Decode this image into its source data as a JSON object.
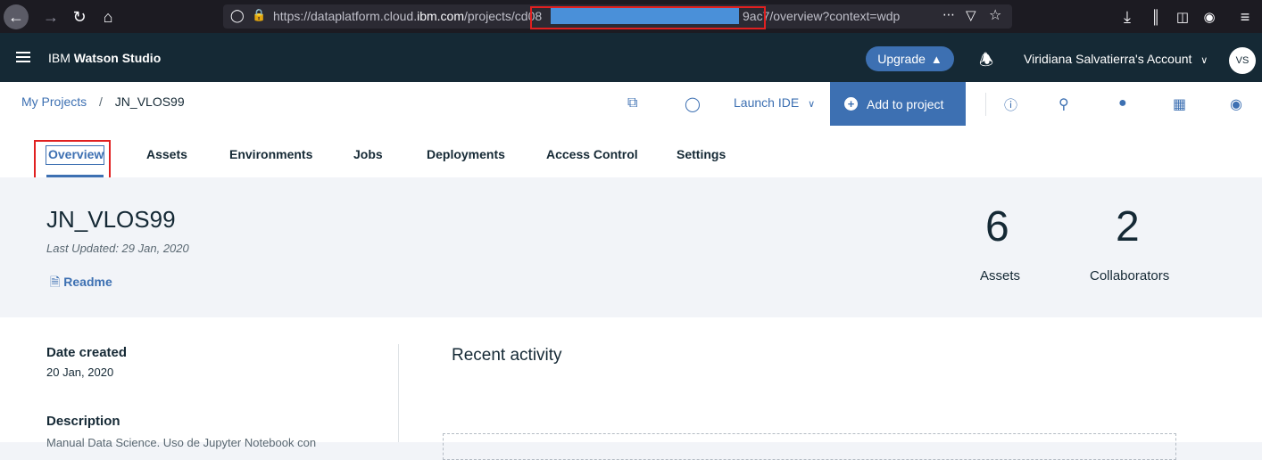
{
  "browser": {
    "url_prefix": "https://dataplatform.cloud.",
    "url_domain": "ibm.com",
    "url_path": "/projects/cd08",
    "url_suffix": "9ac7/overview?context=wdp"
  },
  "header": {
    "brand_prefix": "IBM ",
    "brand_product": "Watson Studio",
    "upgrade_label": "Upgrade",
    "account_label": "Viridiana Salvatierra's Account",
    "avatar_initials": "VS"
  },
  "toolbar": {
    "breadcrumb_root": "My Projects",
    "breadcrumb_sep": "/",
    "breadcrumb_current": "JN_VLOS99",
    "launch_ide_label": "Launch IDE",
    "add_to_project_label": "Add to project"
  },
  "tabs": [
    {
      "label": "Overview",
      "active": true
    },
    {
      "label": "Assets",
      "active": false
    },
    {
      "label": "Environments",
      "active": false
    },
    {
      "label": "Jobs",
      "active": false
    },
    {
      "label": "Deployments",
      "active": false
    },
    {
      "label": "Access Control",
      "active": false
    },
    {
      "label": "Settings",
      "active": false
    }
  ],
  "summary": {
    "project_name": "JN_VLOS99",
    "last_updated": "Last Updated: 29 Jan, 2020",
    "readme_label": "Readme",
    "assets_count": "6",
    "assets_label": "Assets",
    "collaborators_count": "2",
    "collaborators_label": "Collaborators"
  },
  "details": {
    "date_created_label": "Date created",
    "date_created_value": "20 Jan, 2020",
    "description_label": "Description",
    "description_value": "Manual Data Science. Uso de Jupyter Notebook con"
  },
  "activity": {
    "title": "Recent activity"
  },
  "colors": {
    "header_bg": "#152935",
    "accent": "#3d70b2",
    "highlight": "#e02020"
  }
}
